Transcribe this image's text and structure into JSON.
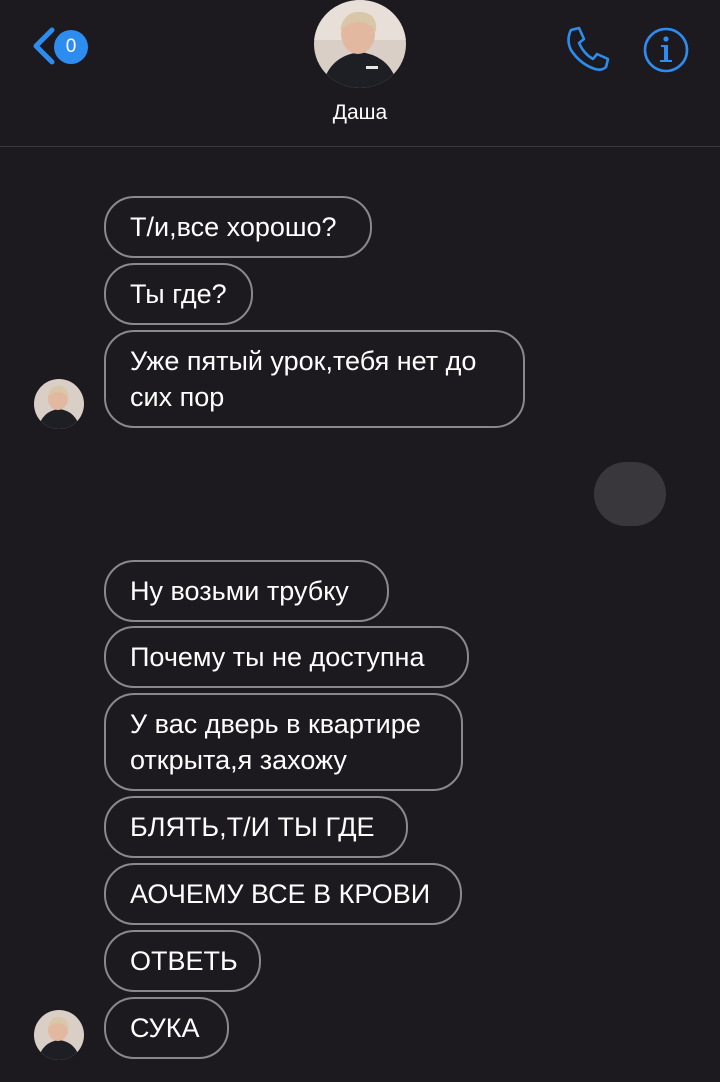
{
  "header": {
    "back_badge": "0",
    "contact_name": "Даша"
  },
  "messages": {
    "m1": "Т/и,все хорошо?",
    "m2": "Ты где?",
    "m3_line1": "Уже пятый урок,тебя нет до",
    "m3_line2": "сих пор",
    "m4": "Ну возьми трубку",
    "m5": "Почему ты не доступна",
    "m6_line1": "У вас дверь в квартире",
    "m6_line2": "открыта,я захожу",
    "m7": "БЛЯТЬ,Т/И ТЫ ГДЕ",
    "m8": "АОЧЕМУ ВСЕ В КРОВИ",
    "m9": "ОТВЕТЬ",
    "m10": "СУКА"
  },
  "colors": {
    "background": "#1c1a1e",
    "accent": "#2d8cf0",
    "bubble_border": "#8a888c",
    "typing_bubble": "#39373b"
  },
  "icons": [
    "chevron-left-icon",
    "phone-icon",
    "info-icon"
  ]
}
